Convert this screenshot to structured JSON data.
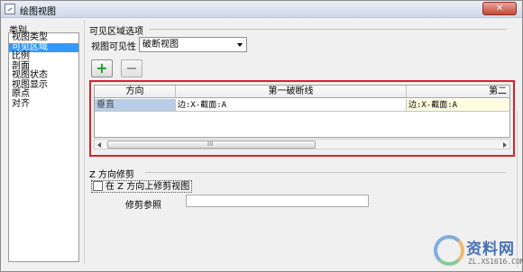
{
  "window": {
    "title": "绘图视图",
    "close_label": "✕"
  },
  "category": {
    "label": "类别",
    "items": [
      {
        "label": "视图类型",
        "selected": false
      },
      {
        "label": "可见区域",
        "selected": true
      },
      {
        "label": "比例",
        "selected": false
      },
      {
        "label": "剖面",
        "selected": false
      },
      {
        "label": "视图状态",
        "selected": false
      },
      {
        "label": "视图显示",
        "selected": false
      },
      {
        "label": "原点",
        "selected": false
      },
      {
        "label": "对齐",
        "selected": false
      }
    ]
  },
  "visible_area": {
    "group_label": "可见区域选项",
    "visibility_label": "视图可见性",
    "visibility_value": "破断视图",
    "add_label": "+"
  },
  "table": {
    "headers": [
      "方向",
      "第一破断线",
      "第二"
    ],
    "row": [
      "垂直",
      "边:X-截面:A",
      "边:X-截面:A"
    ],
    "scroll_grip": "III"
  },
  "z_trim": {
    "group_label": "Z 方向修剪",
    "checkbox_label": "在 Z 方向上修剪视图",
    "trim_ref_label": "修剪参照",
    "trim_ref_value": ""
  },
  "watermark": {
    "title": "资料网",
    "url": "ZL.XS1616.COM"
  },
  "colors": {
    "selection": "#3399ff",
    "highlight_border": "#d6232a",
    "add_icon": "#17a327"
  },
  "icons": [
    "app-icon",
    "close-icon",
    "add-icon",
    "remove-icon",
    "dropdown-arrow-icon"
  ]
}
